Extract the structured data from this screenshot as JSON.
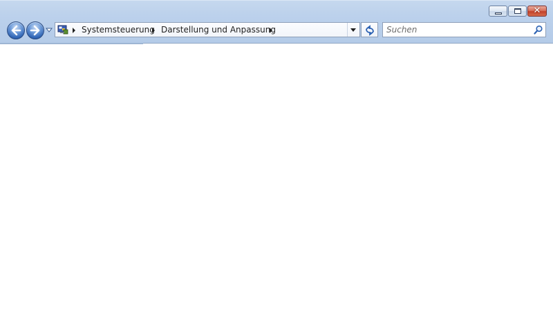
{
  "breadcrumb": {
    "items": [
      "Systemsteuerung",
      "Darstellung und Anpassung"
    ]
  },
  "search": {
    "placeholder": "Suchen"
  },
  "icons": {
    "address": "control-panel-icon",
    "back": "back-arrow-icon",
    "forward": "forward-arrow-icon",
    "refresh": "refresh-icon",
    "search": "magnifier-icon"
  },
  "colors": {
    "frame": "#bcd1ec",
    "nav_button": "#2e63b3",
    "close_button": "#c3412a"
  }
}
